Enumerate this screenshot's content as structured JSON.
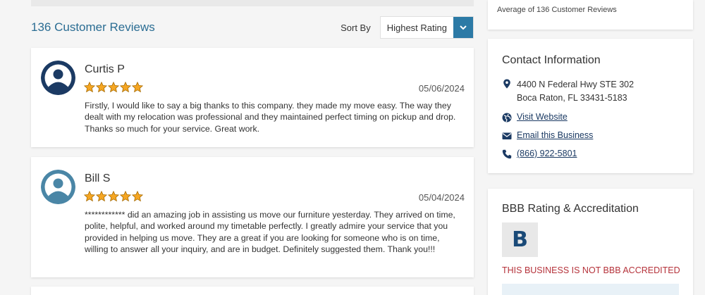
{
  "reviews_header": {
    "count_label": "136 Customer Reviews",
    "sort_label": "Sort By",
    "sort_value": "Highest Rating"
  },
  "reviews": [
    {
      "name": "Curtis P",
      "rating": 5,
      "date": "05/06/2024",
      "text": "Firstly, I would like to say a big thanks to this company. they made my move easy. The way they dealt with my relocation was professional and they maintained perfect timing on pickup and drop. Thanks so much for your service. Great work.",
      "avatar_color": "#1b3a63"
    },
    {
      "name": "Bill S",
      "rating": 5,
      "date": "05/04/2024",
      "text": "************ did an amazing job in assisting us move our furniture yesterday. They arrived on time, polite, helpful, and worked around my timetable perfectly. I greatly admire your service that you provided in helping us move. They are a great if you are looking for someone who is on time, willing to answer all your inquiry, and are in budget. Definitely suggested them. Thank you!!!",
      "avatar_color": "#4a86a6"
    }
  ],
  "sidebar": {
    "average_text": "Average of 136 Customer Reviews",
    "contact": {
      "title": "Contact Information",
      "address_line1": "4400 N Federal Hwy STE 302",
      "address_line2": "Boca Raton, FL 33431-5183",
      "website_label": "Visit Website",
      "email_label": "Email this Business",
      "phone": "(866) 922-5801"
    },
    "bbb": {
      "title": "BBB Rating & Accreditation",
      "grade": "B",
      "notice": "THIS BUSINESS IS NOT BBB ACCREDITED"
    }
  },
  "colors": {
    "accent": "#2c7aa6",
    "link": "#1b3a63",
    "star": "#f5a623",
    "warning": "#b5323a"
  }
}
